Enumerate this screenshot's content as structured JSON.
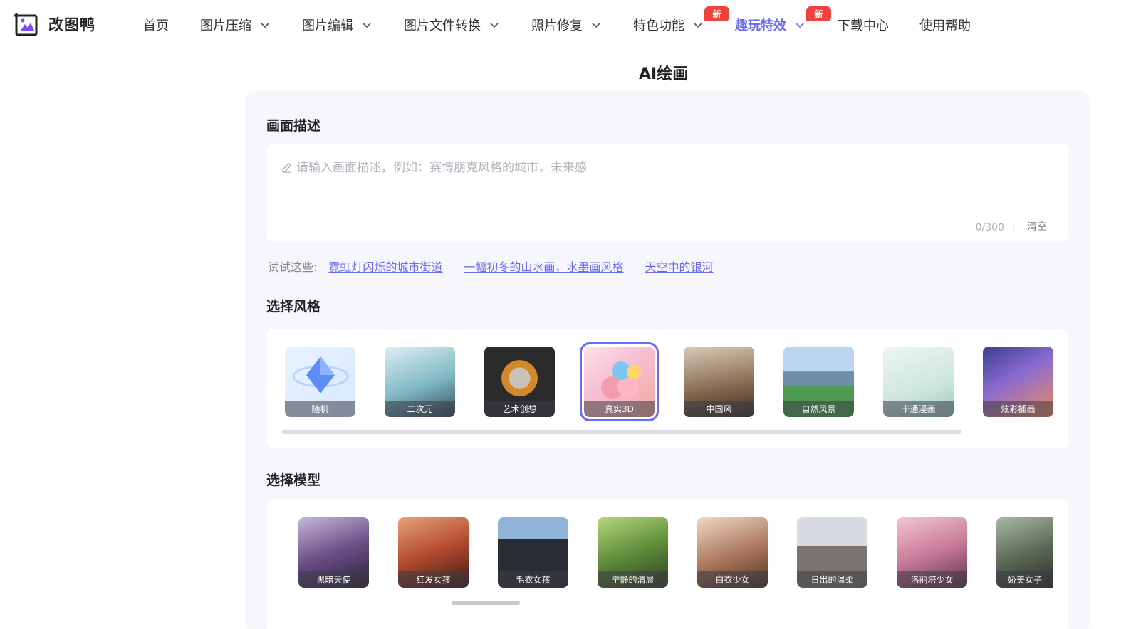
{
  "brand": {
    "name": "改图鸭"
  },
  "nav": {
    "items": [
      {
        "label": "首页",
        "dropdown": false
      },
      {
        "label": "图片压缩",
        "dropdown": true
      },
      {
        "label": "图片编辑",
        "dropdown": true
      },
      {
        "label": "图片文件转换",
        "dropdown": true
      },
      {
        "label": "照片修复",
        "dropdown": true
      },
      {
        "label": "特色功能",
        "dropdown": true,
        "badge": "新"
      },
      {
        "label": "趣玩特效",
        "dropdown": true,
        "badge": "新",
        "active": true
      },
      {
        "label": "下载中心",
        "dropdown": false
      },
      {
        "label": "使用帮助",
        "dropdown": false
      }
    ]
  },
  "page": {
    "title": "AI绘画"
  },
  "prompt": {
    "section_title": "画面描述",
    "placeholder": "请输入画面描述，例如：赛博朋克风格的城市，未来感",
    "counter": "0/300",
    "separator": "|",
    "clear_label": "清空"
  },
  "suggestions": {
    "label": "试试这些:",
    "items": [
      "霓虹灯闪烁的城市街道",
      "一幅初冬的山水画，水墨画风格",
      "天空中的银河"
    ]
  },
  "styles": {
    "section_title": "选择风格",
    "selected": "真实3D",
    "items": [
      "随机",
      "二次元",
      "艺术创想",
      "真实3D",
      "中国风",
      "自然风景",
      "卡通漫画",
      "炫彩插画"
    ]
  },
  "models": {
    "section_title": "选择模型",
    "items": [
      "黑暗天使",
      "红发女孩",
      "毛衣女孩",
      "宁静的清晨",
      "白衣少女",
      "日出的温柔",
      "洛丽塔少女",
      "娇美女子"
    ]
  },
  "colors": {
    "accent": "#6a6af4",
    "badge": "#f0423b",
    "panel_bg": "#f7f7fb"
  }
}
